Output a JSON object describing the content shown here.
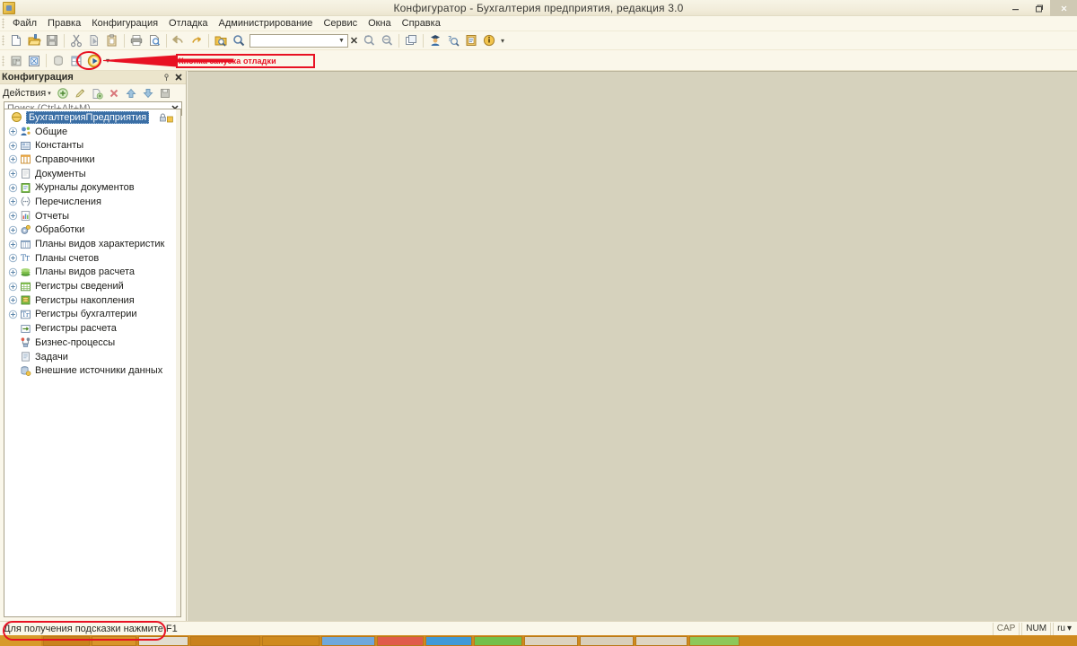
{
  "window": {
    "title": "Конфигуратор - Бухгалтерия предприятия, редакция 3.0",
    "app_icon": "1c-config-icon",
    "buttons": {
      "minimize": "—",
      "restore": "❐",
      "close": "✕"
    }
  },
  "menubar": {
    "items": [
      {
        "label": "Файл",
        "accel": "Ф"
      },
      {
        "label": "Правка",
        "accel": "П"
      },
      {
        "label": "Конфигурация",
        "accel": ""
      },
      {
        "label": "Отладка",
        "accel": ""
      },
      {
        "label": "Администрирование",
        "accel": ""
      },
      {
        "label": "Сервис",
        "accel": "С"
      },
      {
        "label": "Окна",
        "accel": "О"
      },
      {
        "label": "Справка",
        "accel": ""
      }
    ]
  },
  "toolbar_main": {
    "items": [
      {
        "name": "new-icon",
        "tooltip": "Новый"
      },
      {
        "name": "open-icon",
        "tooltip": "Открыть"
      },
      {
        "name": "save-icon",
        "tooltip": "Сохранить"
      },
      {
        "name": "cut-icon",
        "tooltip": "Вырезать"
      },
      {
        "name": "copy-icon",
        "tooltip": "Копировать"
      },
      {
        "name": "paste-icon",
        "tooltip": "Вставить"
      },
      {
        "name": "print-icon",
        "tooltip": "Печать"
      },
      {
        "name": "print-preview-icon",
        "tooltip": "Предварительный просмотр"
      },
      {
        "name": "undo-icon",
        "tooltip": "Отменить"
      },
      {
        "name": "redo-icon",
        "tooltip": "Вернуть"
      },
      {
        "name": "find-in-files-icon",
        "tooltip": "Глобальный поиск"
      },
      {
        "name": "search-icon",
        "tooltip": "Найти"
      }
    ],
    "search_combo": {
      "value": "",
      "placeholder": ""
    },
    "items_right": [
      {
        "name": "find-next-icon",
        "tooltip": "Найти следующий"
      },
      {
        "name": "find-prev-icon",
        "tooltip": "Найти предыдущий"
      },
      {
        "name": "windows-icon",
        "tooltip": "Окна"
      },
      {
        "name": "users-icon",
        "tooltip": "Пользователи"
      },
      {
        "name": "syntax-help-icon",
        "tooltip": "Синтакс-помощник"
      },
      {
        "name": "content-icon",
        "tooltip": "Содержание справки"
      },
      {
        "name": "about-icon",
        "tooltip": "О программе"
      }
    ],
    "overflow_label": "▾"
  },
  "toolbar_debug": {
    "items": [
      {
        "name": "config-window-icon",
        "tooltip": "Окно конфигурации"
      },
      {
        "name": "config-compare-icon",
        "tooltip": "Сравнить конфигурации"
      },
      {
        "name": "database-icon",
        "tooltip": "База данных"
      },
      {
        "name": "config-table-icon",
        "tooltip": "Конфигурация базы данных"
      },
      {
        "name": "start-debug-icon",
        "tooltip": "Начать отладку"
      }
    ],
    "overflow_label": "▾"
  },
  "annotations": {
    "callout_text": "Кнопка запуска отладки",
    "highlight_color": "#e81123",
    "targets": [
      "start-debug-icon",
      "status-hint"
    ]
  },
  "panel": {
    "title": "Конфигурация",
    "pin_label": "⚲",
    "close_label": "✕",
    "actions": {
      "label": "Действия",
      "caret": "▾",
      "buttons": [
        {
          "name": "add-icon",
          "tooltip": "Добавить"
        },
        {
          "name": "edit-icon",
          "tooltip": "Изменить"
        },
        {
          "name": "copy-item-icon",
          "tooltip": "Скопировать"
        },
        {
          "name": "delete-icon",
          "tooltip": "Удалить"
        },
        {
          "name": "move-up-icon",
          "tooltip": "Переместить вверх"
        },
        {
          "name": "move-down-icon",
          "tooltip": "Переместить вниз"
        },
        {
          "name": "save-config-icon",
          "tooltip": "Сохранить"
        }
      ]
    },
    "search": {
      "value": "",
      "placeholder": "Поиск (Ctrl+Alt+M)",
      "clear_label": "✕"
    }
  },
  "tree": {
    "root": {
      "label": "БухгалтерияПредприятия",
      "icon": "config-root-icon",
      "selected": true,
      "lock_icon": "locked-icon"
    },
    "nodes": [
      {
        "label": "Общие",
        "icon": "common-icon",
        "expandable": true
      },
      {
        "label": "Константы",
        "icon": "constants-icon",
        "expandable": true
      },
      {
        "label": "Справочники",
        "icon": "catalogs-icon",
        "expandable": true
      },
      {
        "label": "Документы",
        "icon": "documents-icon",
        "expandable": true
      },
      {
        "label": "Журналы документов",
        "icon": "document-journals-icon",
        "expandable": true
      },
      {
        "label": "Перечисления",
        "icon": "enums-icon",
        "expandable": true
      },
      {
        "label": "Отчеты",
        "icon": "reports-icon",
        "expandable": true
      },
      {
        "label": "Обработки",
        "icon": "data-processors-icon",
        "expandable": true
      },
      {
        "label": "Планы видов характеристик",
        "icon": "chart-of-characteristic-types-icon",
        "expandable": true
      },
      {
        "label": "Планы счетов",
        "icon": "chart-of-accounts-icon",
        "expandable": true
      },
      {
        "label": "Планы видов расчета",
        "icon": "chart-of-calculation-types-icon",
        "expandable": true
      },
      {
        "label": "Регистры сведений",
        "icon": "information-registers-icon",
        "expandable": true
      },
      {
        "label": "Регистры накопления",
        "icon": "accumulation-registers-icon",
        "expandable": true
      },
      {
        "label": "Регистры бухгалтерии",
        "icon": "accounting-registers-icon",
        "expandable": true
      },
      {
        "label": "Регистры расчета",
        "icon": "calculation-registers-icon",
        "expandable": false
      },
      {
        "label": "Бизнес-процессы",
        "icon": "business-processes-icon",
        "expandable": false
      },
      {
        "label": "Задачи",
        "icon": "tasks-icon",
        "expandable": false
      },
      {
        "label": "Внешние источники данных",
        "icon": "external-data-sources-icon",
        "expandable": false
      }
    ]
  },
  "statusbar": {
    "hint": "Для получения подсказки нажмите F1",
    "caps": "CAP",
    "num": "NUM",
    "language": "ru",
    "language_caret": "▾"
  }
}
